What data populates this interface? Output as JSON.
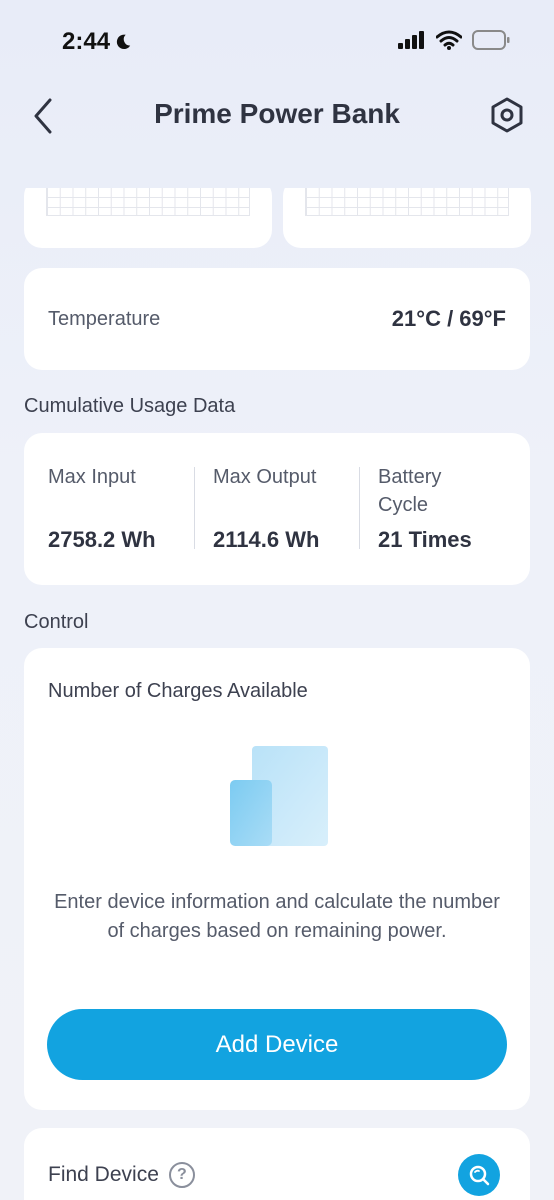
{
  "status_bar": {
    "time": "2:44"
  },
  "header": {
    "title": "Prime Power Bank"
  },
  "temperature": {
    "label": "Temperature",
    "value": "21°C / 69°F"
  },
  "usage": {
    "section_title": "Cumulative Usage Data",
    "items": [
      {
        "label": "Max Input",
        "value": "2758.2 Wh"
      },
      {
        "label": "Max Output",
        "value": "2114.6 Wh"
      },
      {
        "label": "Battery Cycle",
        "value": "21 Times"
      }
    ]
  },
  "control": {
    "section_title": "Control",
    "charges_title": "Number of Charges Available",
    "description": "Enter device information and calculate the number of charges based on remaining power.",
    "add_device_label": "Add Device"
  },
  "find_device": {
    "label": "Find Device"
  },
  "colors": {
    "accent": "#12a3e0",
    "card": "#ffffff",
    "background": "#eef1f9"
  },
  "icons": [
    "moon-icon",
    "signal-icon",
    "wifi-icon",
    "battery-icon",
    "back-chevron-icon",
    "settings-icon",
    "help-icon",
    "search-icon"
  ]
}
